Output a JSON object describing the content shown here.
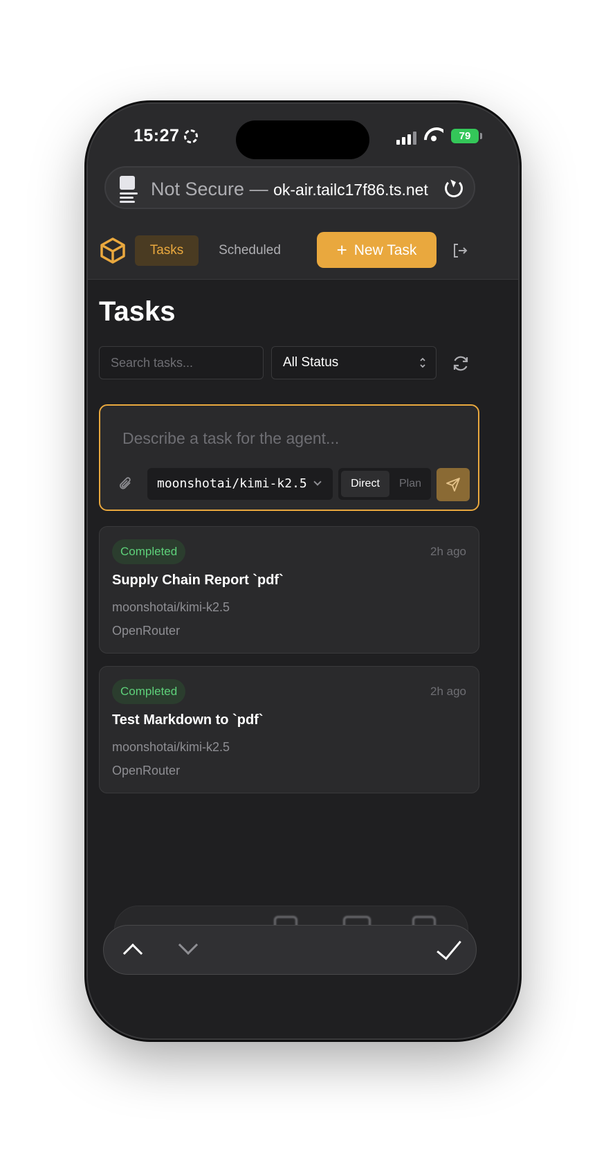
{
  "status_bar": {
    "time": "15:27",
    "battery": "79"
  },
  "browser": {
    "security": "Not Secure — ",
    "domain": "ok-air.tailc17f86.ts.net"
  },
  "nav": {
    "tabs": [
      {
        "label": "Tasks"
      },
      {
        "label": "Scheduled"
      }
    ],
    "new_task_label": "New Task"
  },
  "page": {
    "title": "Tasks"
  },
  "filters": {
    "search_placeholder": "Search tasks...",
    "status_value": "All Status"
  },
  "composer": {
    "placeholder": "Describe a task for the agent...",
    "model": "moonshotai/kimi-k2.5",
    "modes": [
      "Direct",
      "Plan"
    ]
  },
  "tasks": [
    {
      "status": "Completed",
      "time": "2h ago",
      "title": "Supply Chain Report `pdf`",
      "model": "moonshotai/kimi-k2.5",
      "provider": "OpenRouter"
    },
    {
      "status": "Completed",
      "time": "2h ago",
      "title": "Test Markdown to `pdf`",
      "model": "moonshotai/kimi-k2.5",
      "provider": "OpenRouter"
    }
  ],
  "colors": {
    "accent": "#e9a83e",
    "success": "#5ed17a",
    "background": "#1f1f21"
  },
  "icons": [
    "gear-icon",
    "signal-icon",
    "wifi-icon",
    "page-icon",
    "reload-icon",
    "logo-cube-icon",
    "logout-icon",
    "refresh-icon",
    "paperclip-icon",
    "send-icon",
    "chevron-up-icon",
    "chevron-down-icon",
    "checkmark-icon"
  ]
}
